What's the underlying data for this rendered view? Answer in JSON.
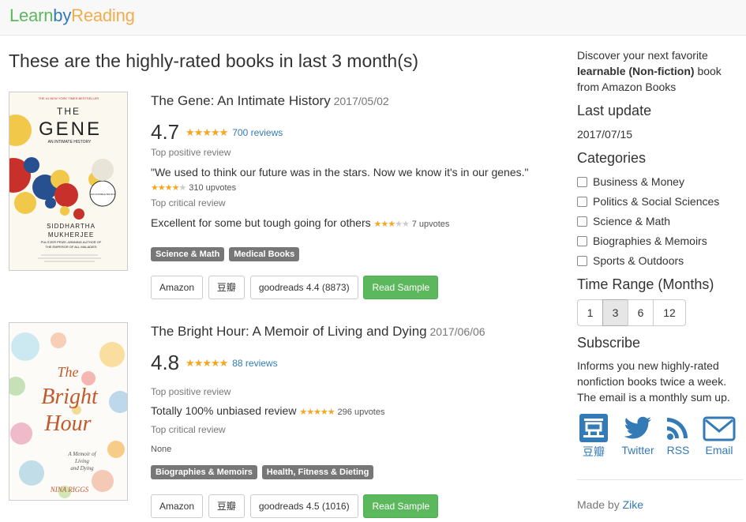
{
  "brand": {
    "part1": "Learn",
    "part2": "by",
    "part3": "Reading"
  },
  "page_title": "These are the highly-rated books in last 3 month(s)",
  "books": [
    {
      "title": "The Gene: An Intimate History",
      "date": "2017/05/02",
      "rating": "4.7",
      "reviews": "700 reviews",
      "positive_label": "Top positive review",
      "positive_text": "\"We used to think our future was in the stars. Now we know it's in our genes.\"",
      "positive_upvotes": "310 upvotes",
      "positive_stars": 4,
      "critical_label": "Top critical review",
      "critical_text": "Excellent for some but tough going for others",
      "critical_upvotes": "7 upvotes",
      "critical_stars": 3,
      "tags": [
        "Science & Math",
        "Medical Books"
      ],
      "buttons": {
        "amazon": "Amazon",
        "douban": "豆瓣",
        "goodreads": "goodreads 4.4 (8873)",
        "sample": "Read Sample"
      },
      "cover": {
        "top_line": "THE #1 NEW YORK TIMES BESTSELLER",
        "title_line1": "THE",
        "title_line2": "GENE",
        "subtitle": "AN INTIMATE HISTORY",
        "badge": "100 NOTABLE BOOKS",
        "author_line1": "SIDDHARTHA",
        "author_line2": "MUKHERJEE",
        "author_note1": "PULITZER PRIZE–WINNING AUTHOR OF",
        "author_note2": "THE EMPEROR OF ALL MALADIES"
      }
    },
    {
      "title": "The Bright Hour: A Memoir of Living and Dying",
      "date": "2017/06/06",
      "rating": "4.8",
      "reviews": "88 reviews",
      "positive_label": "Top positive review",
      "positive_text": "Totally 100% unbiased review",
      "positive_upvotes": "296 upvotes",
      "positive_stars": 5,
      "critical_label": "Top critical review",
      "critical_text": "None",
      "tags": [
        "Biographies & Memoirs",
        "Health, Fitness & Dieting"
      ],
      "buttons": {
        "amazon": "Amazon",
        "douban": "豆瓣",
        "goodreads": "goodreads 4.5 (1016)",
        "sample": "Read Sample"
      },
      "cover": {
        "title_line1": "The",
        "title_line2": "Bright",
        "title_line3": "Hour",
        "subtitle1": "A Memoir of",
        "subtitle2": "Living",
        "subtitle3": "and Dying",
        "author": "NINA RIGGS"
      }
    }
  ],
  "sidebar": {
    "intro_1": "Discover your next favorite",
    "intro_bold": "learnable (Non-fiction)",
    "intro_2": "book",
    "intro_3": "from Amazon Books",
    "last_update_heading": "Last update",
    "last_update_value": "2017/07/15",
    "categories_heading": "Categories",
    "categories": [
      "Business & Money",
      "Politics & Social Sciences",
      "Science & Math",
      "Biographies & Memoirs",
      "Sports & Outdoors"
    ],
    "time_range_heading": "Time Range (Months)",
    "time_range_options": [
      "1",
      "3",
      "6",
      "12"
    ],
    "time_range_selected": "3",
    "subscribe_heading": "Subscribe",
    "subscribe_text_1": "Informs you new highly-rated",
    "subscribe_text_2": "nonfiction books twice a week.",
    "subscribe_text_3": "The email is a monthly sum up.",
    "subscribe_links": [
      {
        "label": "豆瓣",
        "icon": "douban-icon"
      },
      {
        "label": "Twitter",
        "icon": "twitter-icon"
      },
      {
        "label": "RSS",
        "icon": "rss-icon"
      },
      {
        "label": "Email",
        "icon": "email-icon"
      }
    ],
    "footer_text": "Made by",
    "footer_link": "Zike"
  },
  "colors": {
    "brand_green": "#5cb85c",
    "brand_blue": "#337ab7",
    "brand_orange": "#f0ad4e",
    "star": "#f5a623",
    "tag": "#777777",
    "button_green": "#5cb85c"
  }
}
